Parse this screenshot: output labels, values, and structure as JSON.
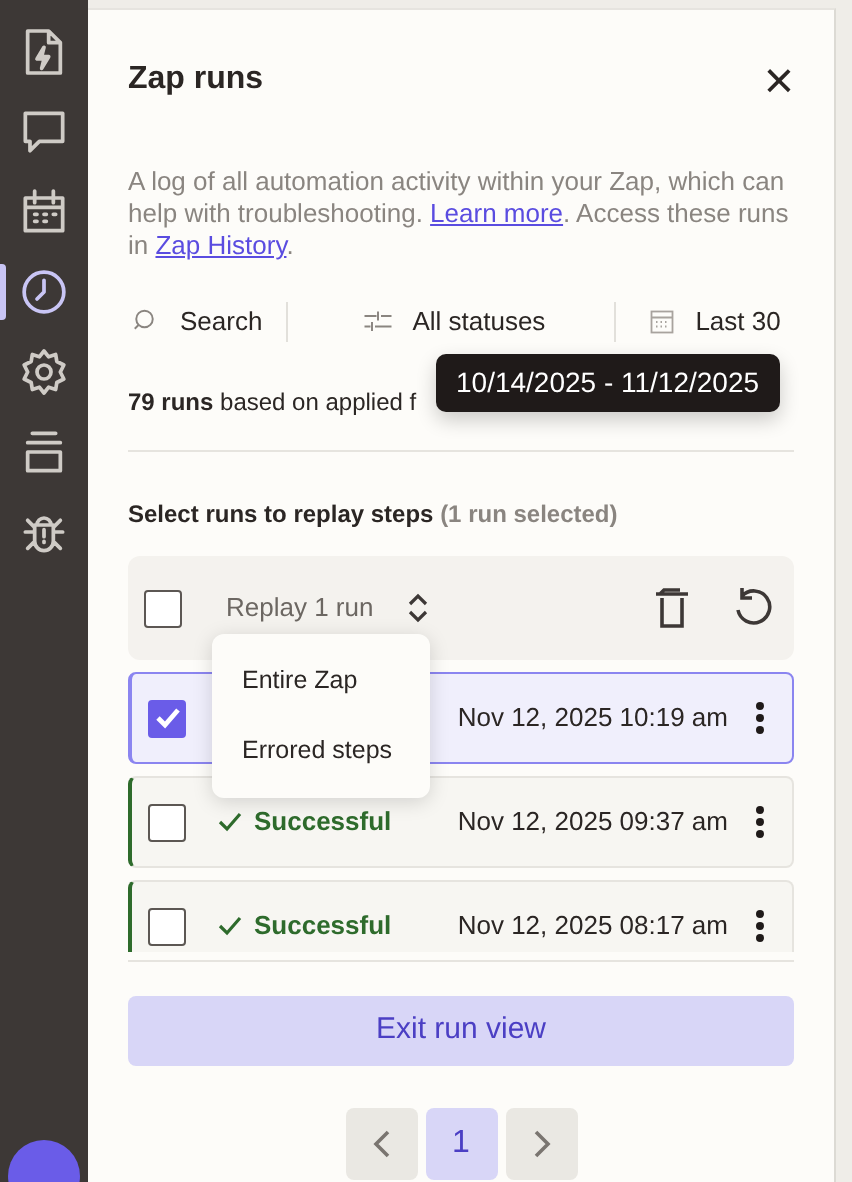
{
  "sidebar": {
    "items": [
      {
        "selected": false
      },
      {
        "selected": false
      },
      {
        "selected": false
      },
      {
        "selected": true
      },
      {
        "selected": false
      },
      {
        "selected": false
      },
      {
        "selected": false
      }
    ]
  },
  "panel": {
    "title": "Zap runs",
    "close": "×",
    "description": {
      "parts": [
        "A log of all automation activity within your Zap, which can help with troubleshooting. ",
        "Learn more",
        ". Access these runs in ",
        "Zap History",
        "."
      ]
    },
    "filters": [
      {
        "kind": "search",
        "label": "Search"
      },
      {
        "kind": "status",
        "label": "All statuses"
      },
      {
        "kind": "date",
        "label": "Last 30"
      }
    ],
    "summary": "**79 runs** based on applied f",
    "tooltip": "10/14/2025 - 11/12/2025",
    "select_heading": "Select runs to replay steps",
    "selected_count": "(1 run selected)",
    "toolbar": {
      "checked": false,
      "replay": "Replay 1 run"
    },
    "runs": [
      {
        "selected": true,
        "checked": true,
        "date": "Nov 12, 2025 10:19 am"
      },
      {
        "selected": false,
        "checked": false,
        "status": "Successful",
        "kind": "success",
        "date": "Nov 12, 2025 09:37 am"
      },
      {
        "selected": false,
        "checked": false,
        "status": "Successful",
        "kind": "success",
        "date": "Nov 12, 2025 08:17 am"
      }
    ],
    "replay_menu": [
      "Entire Zap",
      "Errored steps"
    ],
    "exit_button": "Exit run view",
    "pagination": {
      "pages": [
        {
          "label": "1",
          "selected": true
        }
      ]
    }
  }
}
